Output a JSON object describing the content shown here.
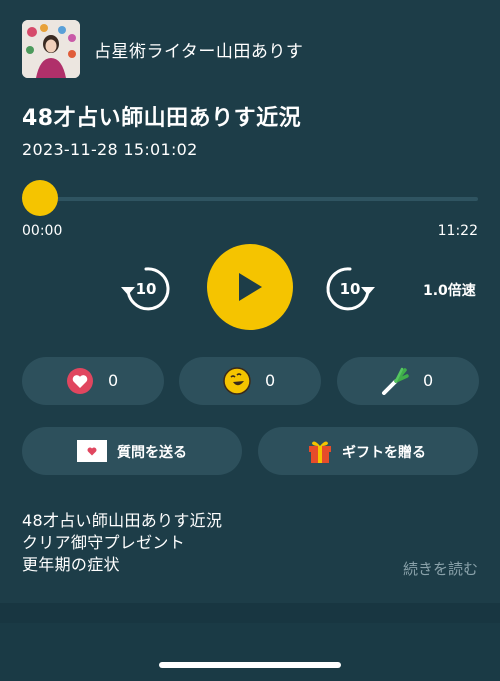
{
  "channel": {
    "name": "占星術ライター山田ありす"
  },
  "episode": {
    "title": "48才占い師山田ありす近況",
    "date": "2023-11-28 15:01:02"
  },
  "player": {
    "current_time": "00:00",
    "total_time": "11:22",
    "progress": 0,
    "skip_back_seconds": "10",
    "skip_forward_seconds": "10",
    "speed_label": "1.0倍速",
    "accent_color": "#f5c400"
  },
  "reactions": [
    {
      "icon": "heart-icon",
      "count": "0"
    },
    {
      "icon": "laugh-icon",
      "count": "0"
    },
    {
      "icon": "leek-icon",
      "count": "0"
    }
  ],
  "actions": {
    "question_label": "質問を送る",
    "gift_label": "ギフトを贈る"
  },
  "description": {
    "lines": [
      "48才占い師山田ありす近況",
      "クリア御守プレゼント",
      "更年期の症状"
    ],
    "read_more": "続きを読む"
  }
}
